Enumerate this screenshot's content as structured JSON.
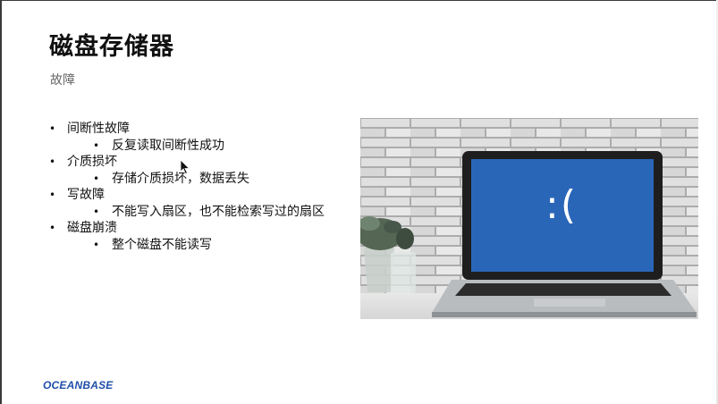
{
  "slide": {
    "title": "磁盘存储器",
    "subtitle": "故障"
  },
  "bullets": [
    {
      "text": "间断性故障",
      "children": [
        "反复读取间断性成功"
      ]
    },
    {
      "text": "介质损坏",
      "children": [
        "存储介质损坏，数据丢失"
      ]
    },
    {
      "text": "写故障",
      "children": [
        "不能写入扇区，也不能检索写过的扇区"
      ]
    },
    {
      "text": "磁盘崩溃",
      "children": [
        "整个磁盘不能读写"
      ]
    }
  ],
  "image": {
    "screen_text": ":(",
    "screen_color": "#2a66b8"
  },
  "footer": {
    "logo_text": "OCEANBASE"
  },
  "colors": {
    "title": "#111111",
    "subtitle": "#666666",
    "logo": "#1f4fa8"
  }
}
